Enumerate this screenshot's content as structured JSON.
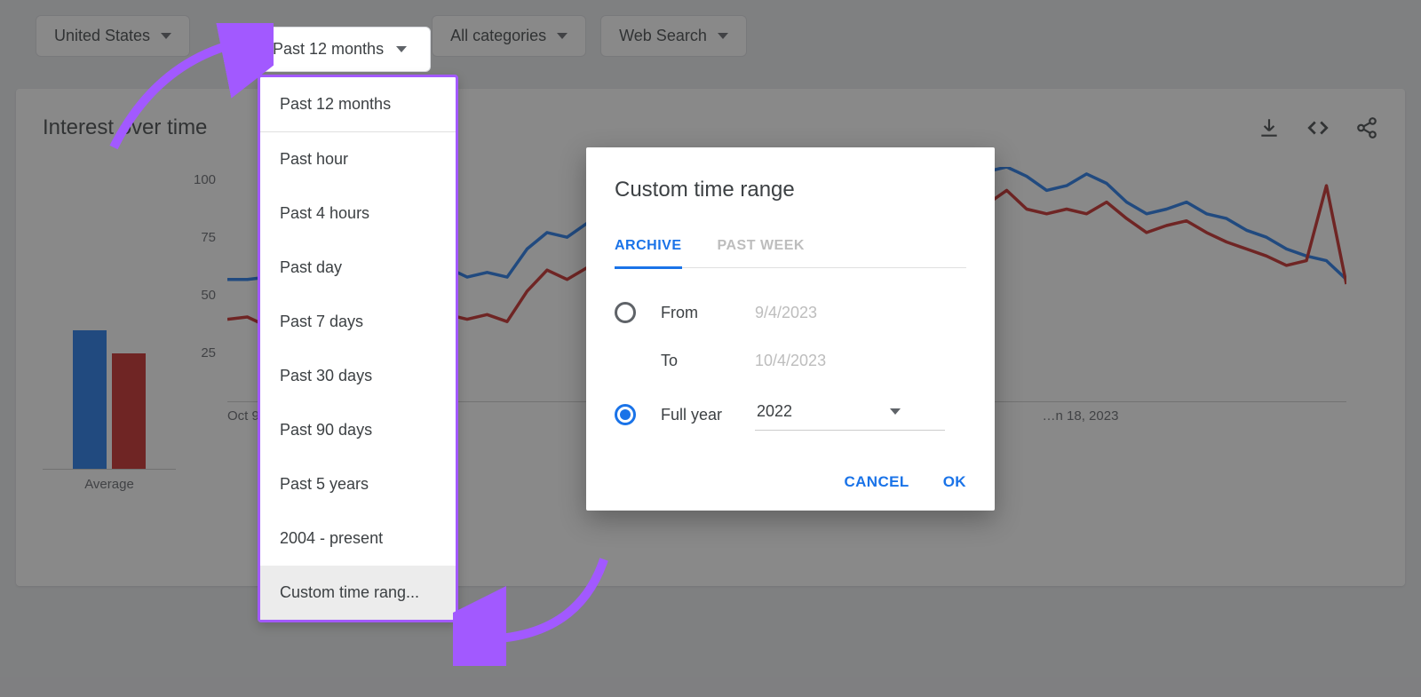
{
  "filters": {
    "region": "United States",
    "timeframe": "Past 12 months",
    "category": "All categories",
    "searchType": "Web Search"
  },
  "chart": {
    "title": "Interest over time",
    "avgLabel": "Average",
    "xTicks": [
      "Oct 9, 2…",
      "…n 18, 2023"
    ],
    "yTicks": [
      "100",
      "75",
      "50",
      "25"
    ]
  },
  "dropdown": {
    "header": "Past 12 months",
    "items": [
      "Past hour",
      "Past 4 hours",
      "Past day",
      "Past 7 days",
      "Past 30 days",
      "Past 90 days",
      "Past 5 years",
      "2004 - present"
    ],
    "custom": "Custom time rang..."
  },
  "dialog": {
    "title": "Custom time range",
    "tabArchive": "ARCHIVE",
    "tabPastWeek": "PAST WEEK",
    "fromLabel": "From",
    "fromValue": "9/4/2023",
    "toLabel": "To",
    "toValue": "10/4/2023",
    "fullYearLabel": "Full year",
    "yearValue": "2022",
    "cancel": "CANCEL",
    "ok": "OK"
  },
  "chart_data": {
    "type": "line",
    "title": "Interest over time",
    "ylabel": "",
    "ylim": [
      0,
      100
    ],
    "x_start": "Oct 9, 2022",
    "x_visible_end": "Jun 18, 2023",
    "avg_bars": {
      "series1": 60,
      "series2": 50
    },
    "series": [
      {
        "name": "series-1",
        "color": "#1a73e8",
        "values": [
          52,
          52,
          53,
          47,
          43,
          49,
          54,
          58,
          54,
          53,
          53,
          57,
          53,
          55,
          53,
          65,
          72,
          70,
          76,
          78,
          78,
          73,
          82,
          77,
          80,
          83,
          86,
          87,
          80,
          78,
          85,
          85,
          90,
          92,
          92,
          96,
          94,
          95,
          98,
          100,
          96,
          90,
          92,
          97,
          93,
          85,
          80,
          82,
          85,
          80,
          78,
          73,
          70,
          65,
          62,
          60,
          52
        ]
      },
      {
        "name": "series-2",
        "color": "#c5221f",
        "values": [
          35,
          36,
          32,
          33,
          30,
          33,
          30,
          32,
          35,
          38,
          35,
          37,
          35,
          37,
          34,
          47,
          56,
          52,
          57,
          60,
          58,
          57,
          64,
          62,
          65,
          68,
          70,
          72,
          68,
          66,
          72,
          72,
          78,
          83,
          84,
          88,
          80,
          80,
          84,
          90,
          82,
          80,
          82,
          80,
          85,
          78,
          72,
          75,
          77,
          72,
          68,
          65,
          62,
          58,
          60,
          92,
          50
        ]
      }
    ]
  }
}
